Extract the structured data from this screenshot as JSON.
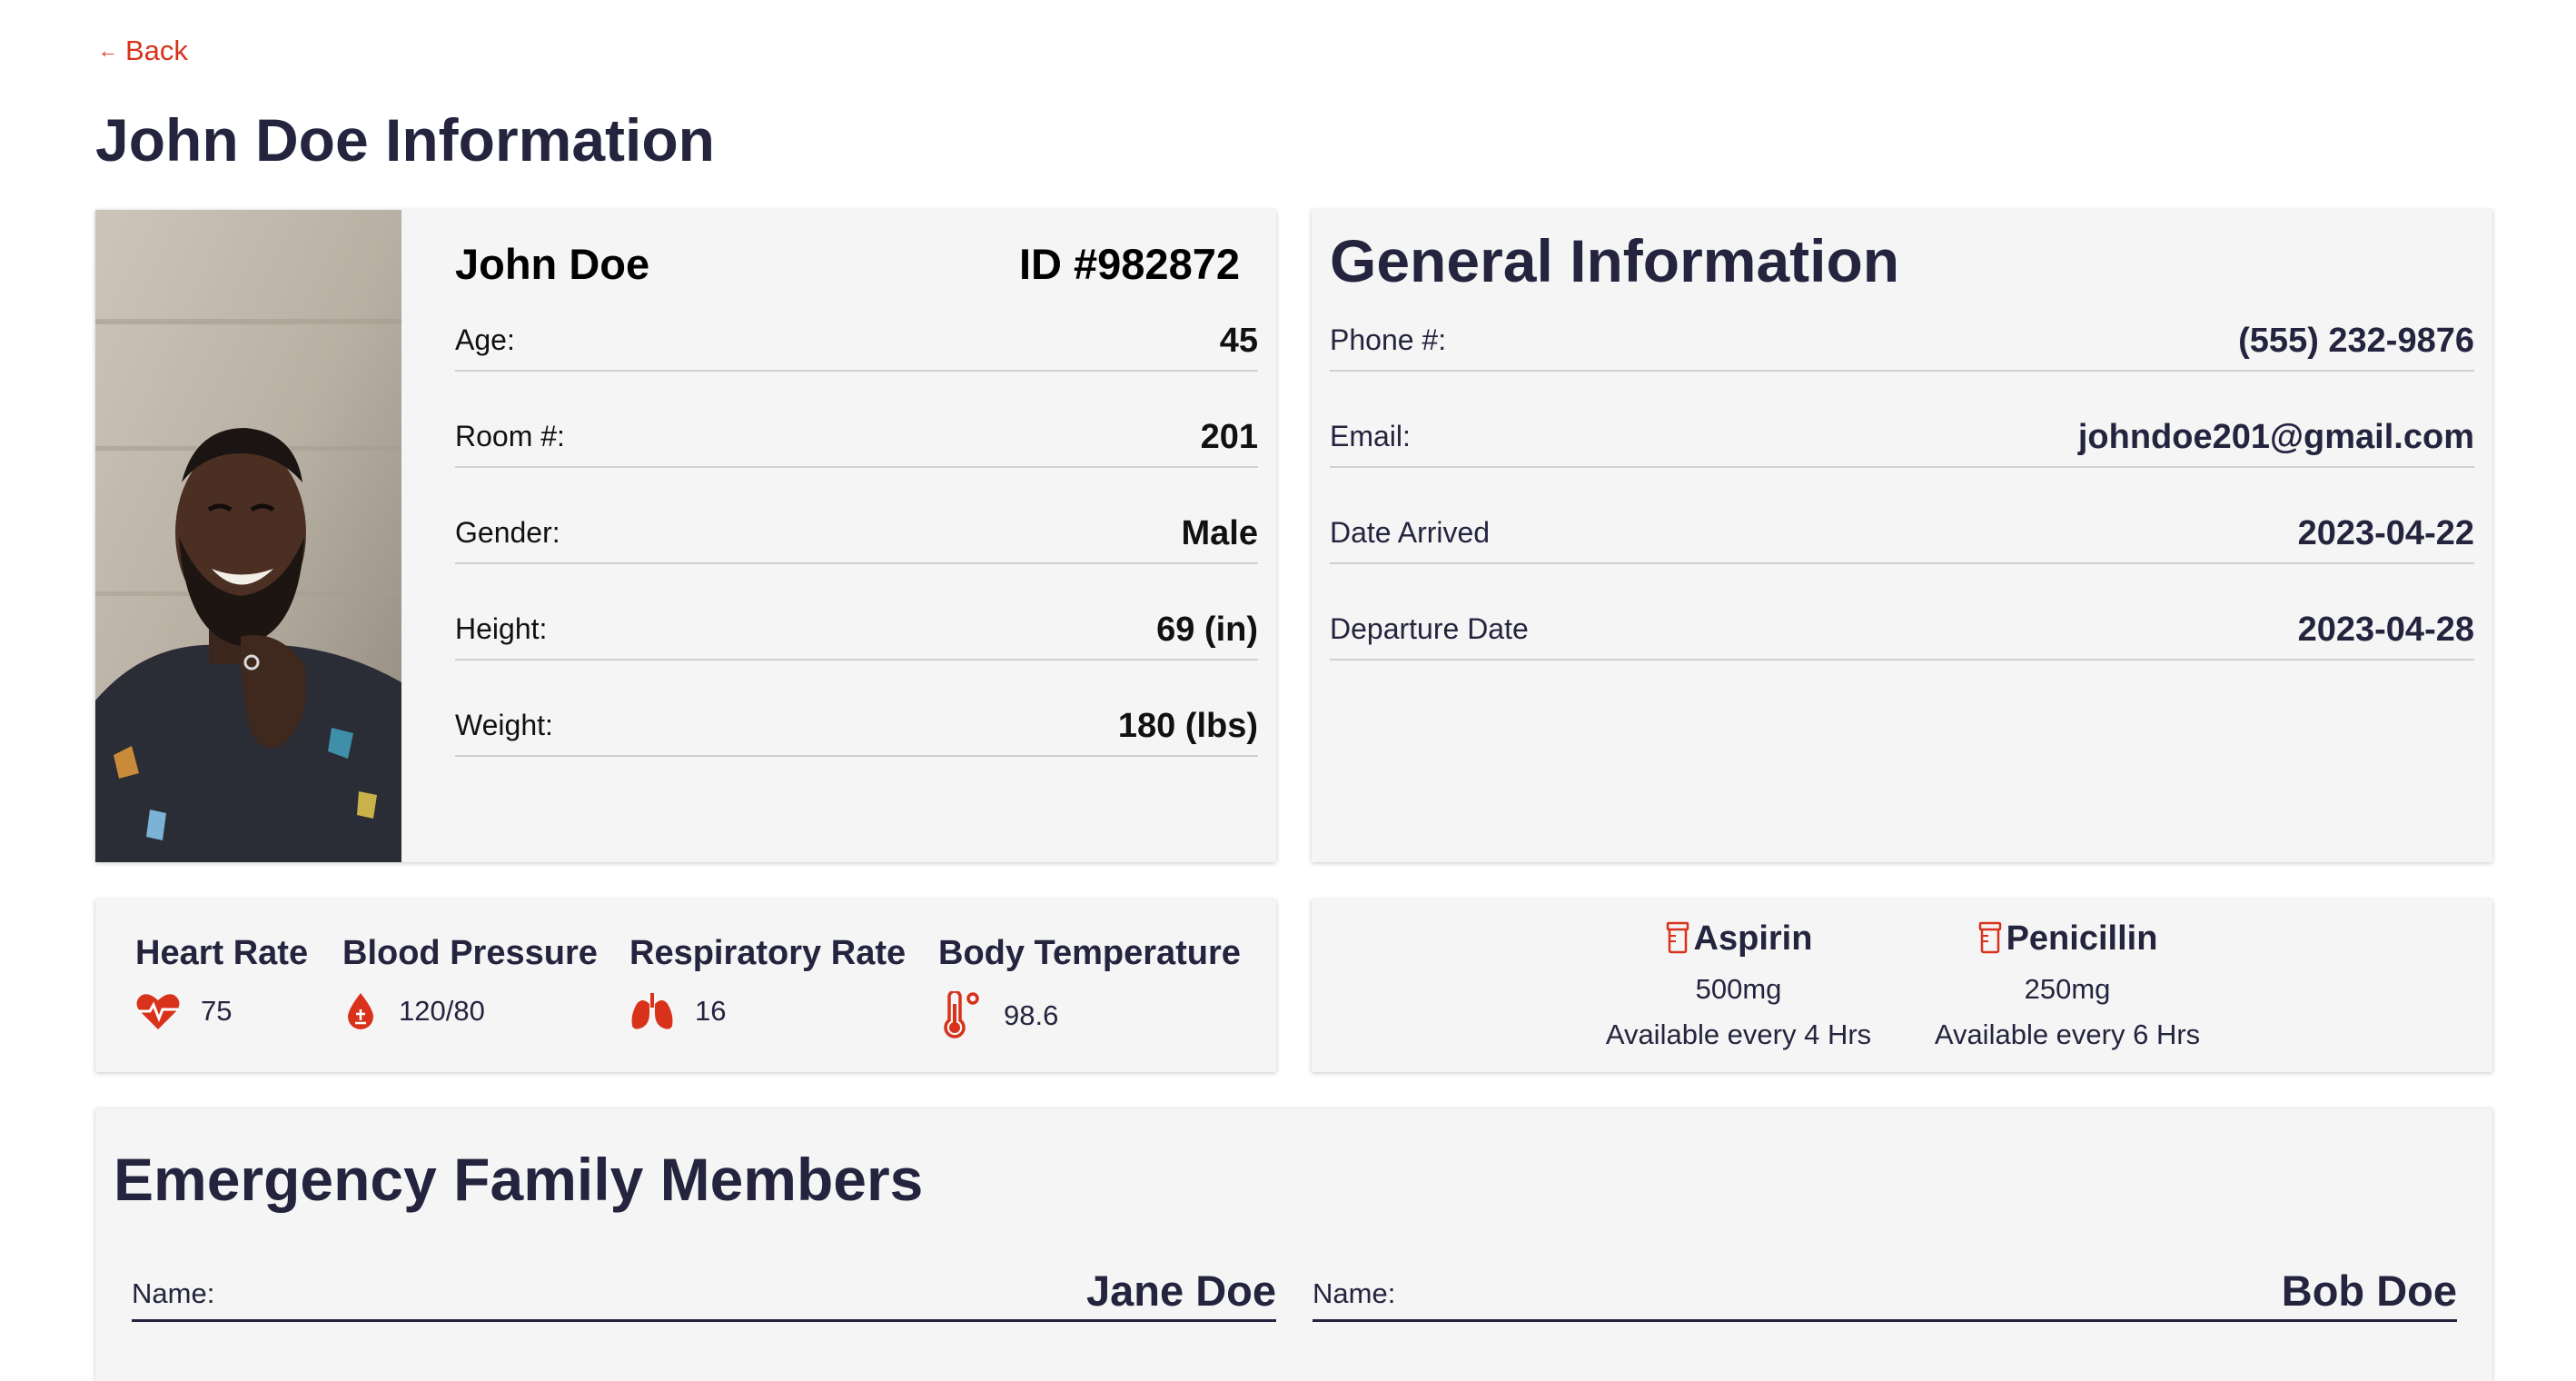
{
  "nav": {
    "back_label": "Back"
  },
  "page": {
    "title": "John Doe Information"
  },
  "patient": {
    "name": "John Doe",
    "id": "ID #982872",
    "fields": [
      {
        "label": "Age:",
        "value": "45"
      },
      {
        "label": "Room #:",
        "value": "201"
      },
      {
        "label": "Gender:",
        "value": "Male"
      },
      {
        "label": "Height:",
        "value": "69 (in)"
      },
      {
        "label": "Weight:",
        "value": "180 (lbs)"
      }
    ]
  },
  "general": {
    "title": "General Information",
    "fields": [
      {
        "label": "Phone #:",
        "value": "(555) 232-9876"
      },
      {
        "label": "Email:",
        "value": "johndoe201@gmail.com"
      },
      {
        "label": "Date Arrived",
        "value": "2023-04-22"
      },
      {
        "label": "Departure Date",
        "value": "2023-04-28"
      }
    ]
  },
  "vitals": [
    {
      "label": "Heart Rate",
      "value": "75",
      "icon": "heart-pulse-icon"
    },
    {
      "label": "Blood Pressure",
      "value": "120/80",
      "icon": "blood-drop-icon"
    },
    {
      "label": "Respiratory Rate",
      "value": "16",
      "icon": "lungs-icon"
    },
    {
      "label": "Body Temperature",
      "value": "98.6",
      "icon": "thermometer-icon"
    }
  ],
  "medications": [
    {
      "name": "Aspirin",
      "dose": "500mg",
      "frequency": "Available every 4 Hrs",
      "icon": "pill-bottle-icon"
    },
    {
      "name": "Penicillin",
      "dose": "250mg",
      "frequency": "Available every 6 Hrs",
      "icon": "pill-bottle-icon"
    }
  ],
  "emergency": {
    "title": "Emergency Family Members",
    "members": [
      {
        "label": "Name:",
        "value": "Jane Doe"
      },
      {
        "label": "Name:",
        "value": "Bob Doe"
      }
    ]
  },
  "colors": {
    "accent": "#d8321b",
    "heading": "#24243f",
    "card_bg": "#f5f5f5"
  }
}
